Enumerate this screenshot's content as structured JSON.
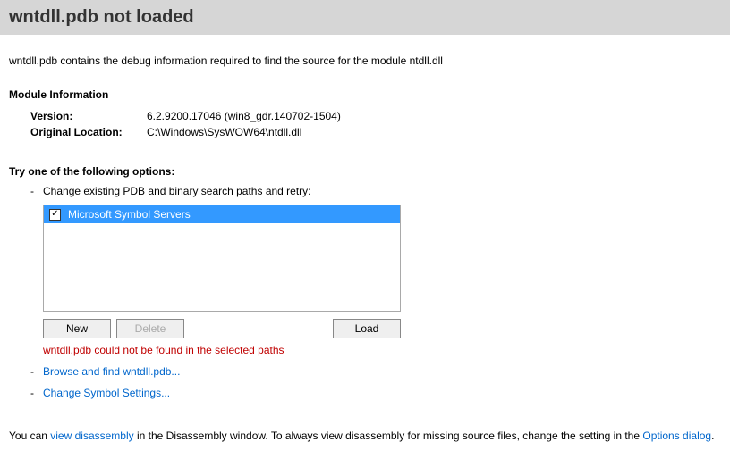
{
  "header": {
    "title": "wntdll.pdb not loaded"
  },
  "description": "wntdll.pdb contains the debug information required to find the source for the module ntdll.dll",
  "moduleInfo": {
    "heading": "Module Information",
    "versionLabel": "Version:",
    "versionValue": "6.2.9200.17046 (win8_gdr.140702-1504)",
    "locationLabel": "Original Location:",
    "locationValue": "C:\\Windows\\SysWOW64\\ntdll.dll"
  },
  "options": {
    "heading": "Try one of the following options:",
    "bullet": "-",
    "changePathsText": "Change existing PDB and binary search paths and retry:",
    "symbolServers": {
      "checked": "✓",
      "label": "Microsoft Symbol Servers"
    },
    "buttons": {
      "new": "New",
      "delete": "Delete",
      "load": "Load"
    },
    "errorText": "wntdll.pdb could not be found in the selected paths",
    "browseLink": "Browse and find wntdll.pdb...",
    "changeSettingsLink": "Change Symbol Settings..."
  },
  "footer": {
    "prefix": "You can ",
    "viewDisassemblyLink": "view disassembly",
    "middle": " in the Disassembly window. To always view disassembly for missing source files, change the setting in the ",
    "optionsDialogLink": "Options dialog",
    "suffix": "."
  }
}
